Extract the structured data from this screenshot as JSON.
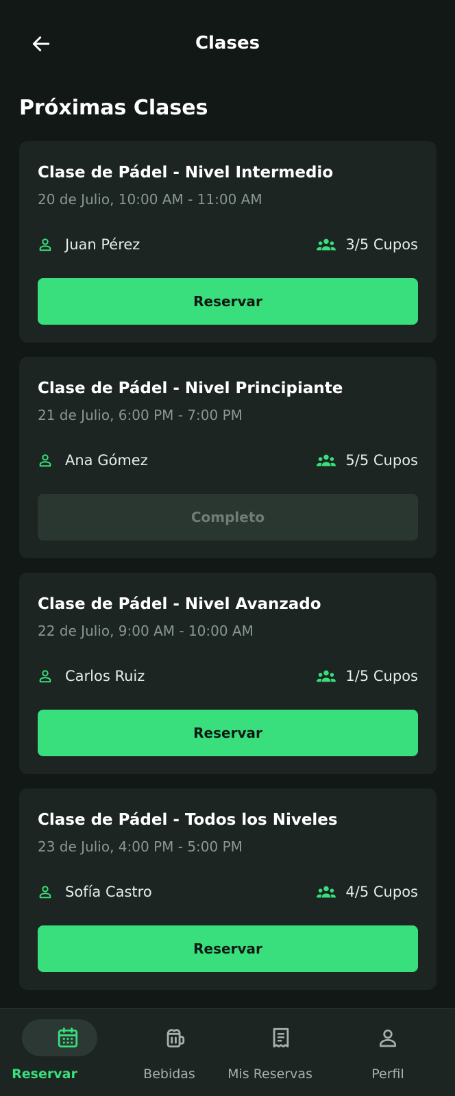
{
  "header": {
    "title": "Clases",
    "back_icon": "arrow-left-icon"
  },
  "section_title": "Próximas Clases",
  "colors": {
    "background": "#111816",
    "card": "#1c2521",
    "accent": "#38df7c",
    "disabled_button": "#2a3731",
    "muted_text": "#8a9891"
  },
  "classes": [
    {
      "title": "Clase de Pádel - Nivel Intermedio",
      "time": "20 de Julio, 10:00 AM - 11:00 AM",
      "instructor": "Juan Pérez",
      "spots": "3/5 Cupos",
      "button_label": "Reservar",
      "button_state": "enabled"
    },
    {
      "title": "Clase de Pádel - Nivel Principiante",
      "time": "21 de Julio, 6:00 PM - 7:00 PM",
      "instructor": "Ana Gómez",
      "spots": "5/5 Cupos",
      "button_label": "Completo",
      "button_state": "disabled"
    },
    {
      "title": "Clase de Pádel - Nivel Avanzado",
      "time": "22 de Julio, 9:00 AM - 10:00 AM",
      "instructor": "Carlos Ruiz",
      "spots": "1/5 Cupos",
      "button_label": "Reservar",
      "button_state": "enabled"
    },
    {
      "title": "Clase de Pádel - Todos los Niveles",
      "time": "23 de Julio, 4:00 PM - 5:00 PM",
      "instructor": "Sofía Castro",
      "spots": "4/5 Cupos",
      "button_label": "Reservar",
      "button_state": "enabled"
    }
  ],
  "bottom_nav": {
    "items": [
      {
        "label": "Reservar",
        "icon": "calendar-icon",
        "active": true
      },
      {
        "label": "Bebidas",
        "icon": "beer-mug-icon",
        "active": false
      },
      {
        "label": "Mis Reservas",
        "icon": "receipt-icon",
        "active": false
      },
      {
        "label": "Perfil",
        "icon": "person-icon",
        "active": false
      }
    ]
  }
}
